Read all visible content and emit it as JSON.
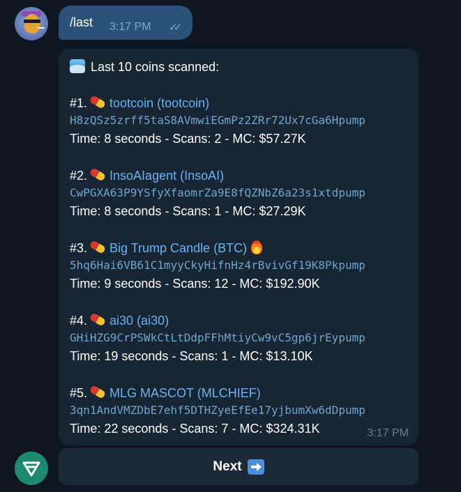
{
  "outgoing": {
    "command": "/last",
    "time": "3:17 PM",
    "status_icon": "double-check-icon"
  },
  "message": {
    "header": "Last 10 coins scanned:",
    "header_icon": "wave-icon",
    "entries": [
      {
        "index": "#1.",
        "name": "tootcoin (tootcoin)",
        "address": "H8zQSz5zrff5taS8AVmwiEGmPz2ZRr72Ux7cGa6Hpump",
        "stats": "Time: 8 seconds - Scans: 2 - MC: $57.27K"
      },
      {
        "index": "#2.",
        "name": "InsoAIagent (InsoAI)",
        "address": "CwPGXA63P9YSfyXfaomrZa9E8fQZNbZ6a23s1xtdpump",
        "stats": "Time: 8 seconds - Scans: 1 - MC: $27.29K"
      },
      {
        "index": "#3.",
        "name": "Big Trump Candle (BTC)",
        "address": "5hq6Hai6VB61C1myyCkyHifnHz4rBvivGf19K8Pkpump",
        "stats": "Time: 9 seconds - Scans: 12 - MC: $192.90K"
      },
      {
        "index": "#4.",
        "name": "ai30 (ai30)",
        "address": "GHiHZG9CrPSWkCtLtDdpFFhMtiyCw9vC5gp6jrEypump",
        "stats": "Time: 19 seconds - Scans: 1 - MC: $13.10K"
      },
      {
        "index": "#5.",
        "name": "MLG MASCOT (MLCHIEF)",
        "address": "3qn1AndVMZDbE7ehf5DTHZyeEfEe17yjbumXw6dDpump",
        "stats": "Time: 22 seconds - Scans: 7 - MC: $324.31K"
      }
    ],
    "time": "3:17 PM"
  },
  "keyboard": {
    "next_label": "Next"
  }
}
